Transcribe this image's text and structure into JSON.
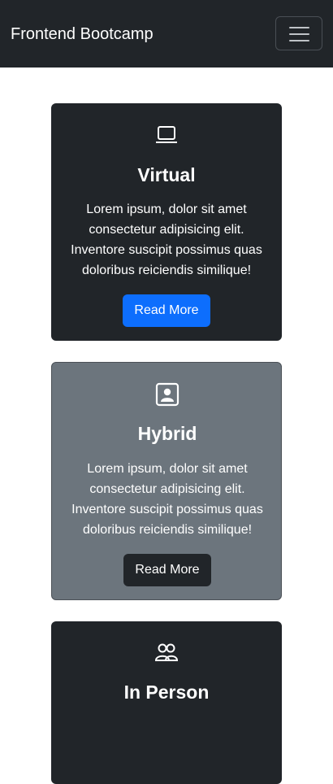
{
  "navbar": {
    "brand": "Frontend Bootcamp",
    "toggler_icon": "hamburger-menu-icon"
  },
  "cards": [
    {
      "icon": "laptop-icon",
      "title": "Virtual",
      "text": "Lorem ipsum, dolor sit amet consectetur adipisicing elit. Inventore suscipit possimus quas doloribus reiciendis similique!",
      "button": "Read More",
      "background": "#212529",
      "button_color": "#0d6efd"
    },
    {
      "icon": "person-badge-icon",
      "title": "Hybrid",
      "text": "Lorem ipsum, dolor sit amet consectetur adipisicing elit. Inventore suscipit possimus quas doloribus reiciendis similique!",
      "button": "Read More",
      "background": "#6c757d",
      "button_color": "#212529"
    },
    {
      "icon": "people-icon",
      "title": "In Person",
      "background": "#212529"
    }
  ]
}
